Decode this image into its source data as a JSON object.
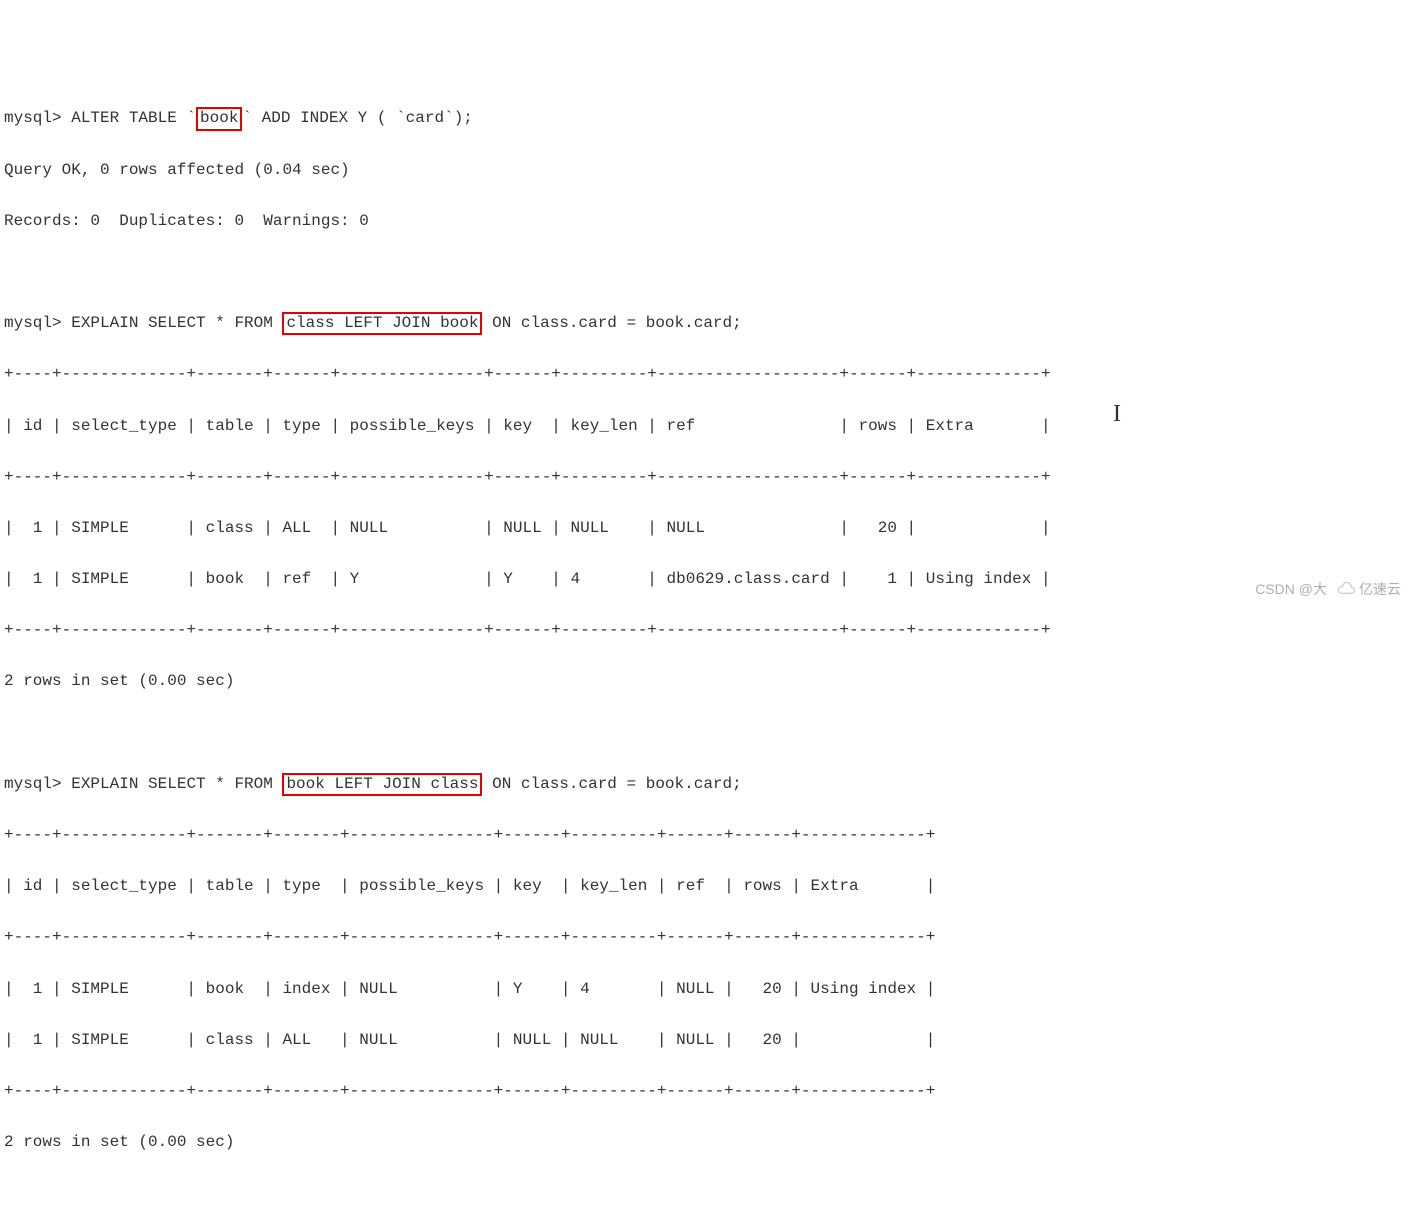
{
  "cmd1": {
    "prompt": "mysql> ",
    "pre": "ALTER TABLE `",
    "boxed": "book",
    "post": "` ADD INDEX Y ( `card`);"
  },
  "result1": {
    "line1": "Query OK, 0 rows affected (0.04 sec)",
    "line2": "Records: 0  Duplicates: 0  Warnings: 0"
  },
  "cmd2": {
    "prompt": "mysql> ",
    "pre": "EXPLAIN SELECT * FROM ",
    "boxed": "class LEFT JOIN book",
    "post": " ON class.card = book.card;"
  },
  "table1": {
    "sep": "+----+-------------+-------+------+---------------+------+---------+-------------------+------+-------------+",
    "header": "| id | select_type | table | type | possible_keys | key  | key_len | ref               | rows | Extra       |",
    "row1": "|  1 | SIMPLE      | class | ALL  | NULL          | NULL | NULL    | NULL              |   20 |             |",
    "row2": "|  1 | SIMPLE      | book  | ref  | Y             | Y    | 4       | db0629.class.card |    1 | Using index |",
    "footer": "2 rows in set (0.00 sec)"
  },
  "cmd3": {
    "prompt": "mysql> ",
    "pre": "EXPLAIN SELECT * FROM ",
    "boxed": "book LEFT JOIN class",
    "post": " ON class.card = book.card;"
  },
  "table2": {
    "sep": "+----+-------------+-------+-------+---------------+------+---------+------+------+-------------+",
    "header": "| id | select_type | table | type  | possible_keys | key  | key_len | ref  | rows | Extra       |",
    "row1": "|  1 | SIMPLE      | book  | index | NULL          | Y    | 4       | NULL |   20 | Using index |",
    "row2": "|  1 | SIMPLE      | class | ALL   | NULL          | NULL | NULL    | NULL |   20 |             |",
    "footer": "2 rows in set (0.00 sec)"
  },
  "watermark": {
    "csdn": "CSDN @大",
    "yisu": "亿速云"
  }
}
